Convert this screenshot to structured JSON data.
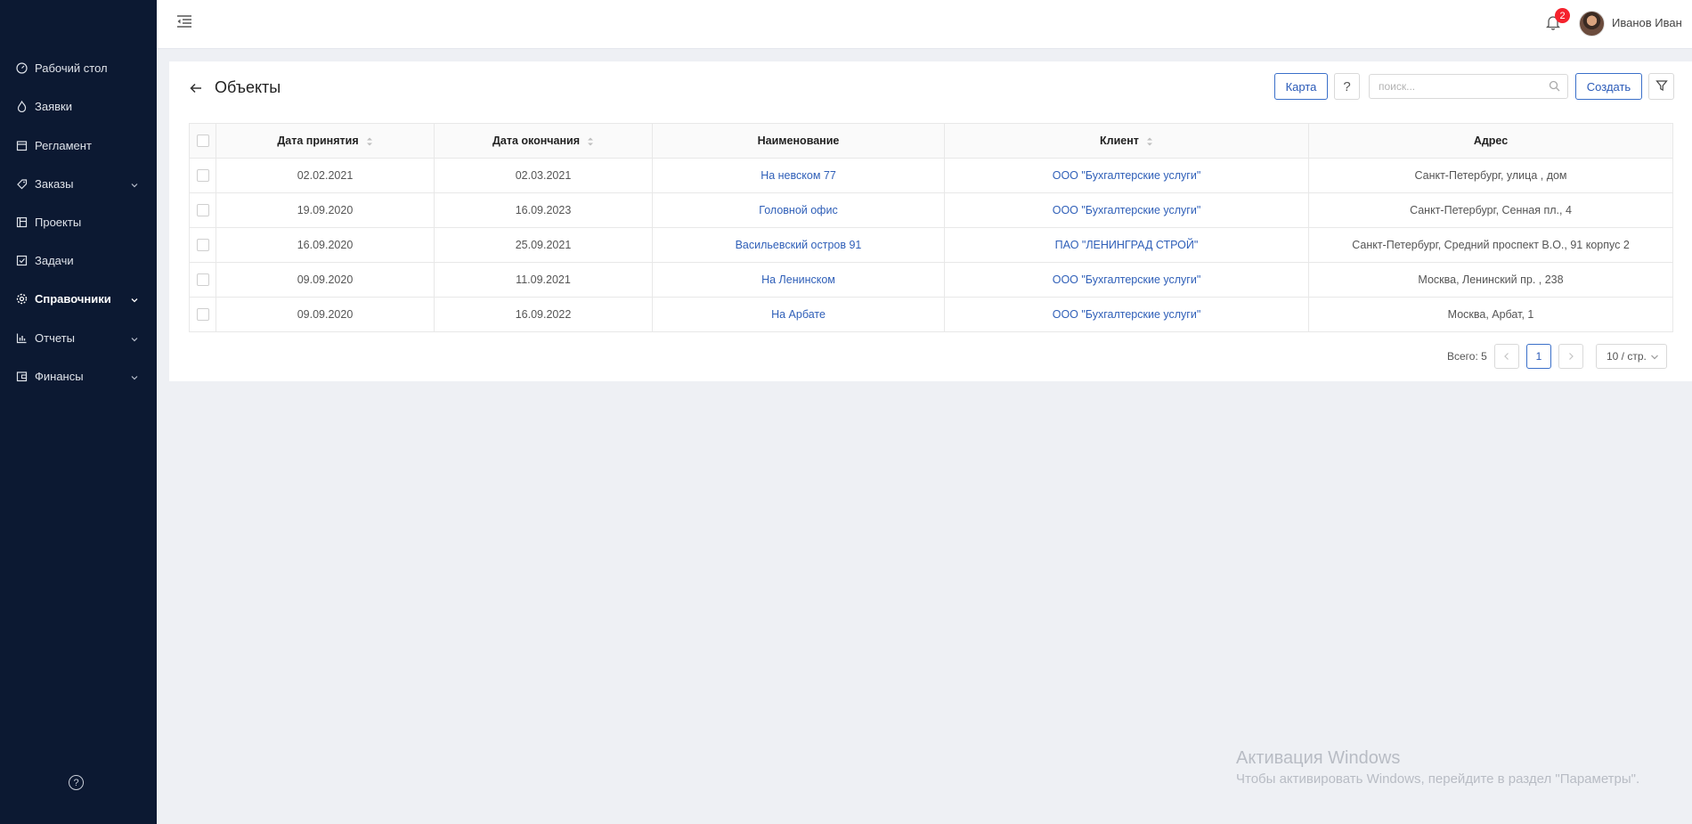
{
  "sidebar": {
    "items": [
      {
        "label": "Рабочий стол",
        "icon": "dashboard-icon"
      },
      {
        "label": "Заявки",
        "icon": "fire-icon"
      },
      {
        "label": "Регламент",
        "icon": "calendar-icon"
      },
      {
        "label": "Заказы",
        "icon": "tag-icon",
        "has_submenu": true
      },
      {
        "label": "Проекты",
        "icon": "project-icon"
      },
      {
        "label": "Задачи",
        "icon": "checkbox-icon"
      },
      {
        "label": "Справочники",
        "icon": "gear-icon",
        "has_submenu": true,
        "active": true
      },
      {
        "label": "Отчеты",
        "icon": "bar-chart-icon",
        "has_submenu": true
      },
      {
        "label": "Финансы",
        "icon": "wallet-icon",
        "has_submenu": true
      }
    ],
    "help_label": "?"
  },
  "header": {
    "notification_count": "2",
    "user_name": "Иванов Иван"
  },
  "page": {
    "title": "Объекты",
    "map_button": "Карта",
    "help_button": "?",
    "search_placeholder": "поиск...",
    "create_button": "Создать"
  },
  "table": {
    "columns": [
      "Дата принятия",
      "Дата окончания",
      "Наименование",
      "Клиент",
      "Адрес"
    ],
    "rows": [
      {
        "start": "02.02.2021",
        "end": "02.03.2021",
        "name": "На невском 77",
        "client": "ООО \"Бухгалтерские услуги\"",
        "address": "Санкт-Петербург, улица , дом"
      },
      {
        "start": "19.09.2020",
        "end": "16.09.2023",
        "name": "Головной офис",
        "client": "ООО \"Бухгалтерские услуги\"",
        "address": "Санкт-Петербург, Сенная пл., 4"
      },
      {
        "start": "16.09.2020",
        "end": "25.09.2021",
        "name": "Васильевский остров 91",
        "client": "ПАО \"ЛЕНИНГРАД СТРОЙ\"",
        "address": "Санкт-Петербург, Средний проспект В.О., 91 корпус 2"
      },
      {
        "start": "09.09.2020",
        "end": "11.09.2021",
        "name": "На Ленинском",
        "client": "ООО \"Бухгалтерские услуги\"",
        "address": "Москва, Ленинский пр. , 238"
      },
      {
        "start": "09.09.2020",
        "end": "16.09.2022",
        "name": "На Арбате",
        "client": "ООО \"Бухгалтерские услуги\"",
        "address": "Москва, Арбат, 1"
      }
    ]
  },
  "pagination": {
    "total_label": "Всего: 5",
    "current_page": "1",
    "page_size": "10 / стр."
  },
  "watermark": {
    "title": "Активация Windows",
    "subtitle": "Чтобы активировать Windows, перейдите в раздел \"Параметры\"."
  },
  "colors": {
    "sidebar_bg": "#0c1932",
    "accent": "#2f5fb8",
    "badge": "#f5222d"
  }
}
